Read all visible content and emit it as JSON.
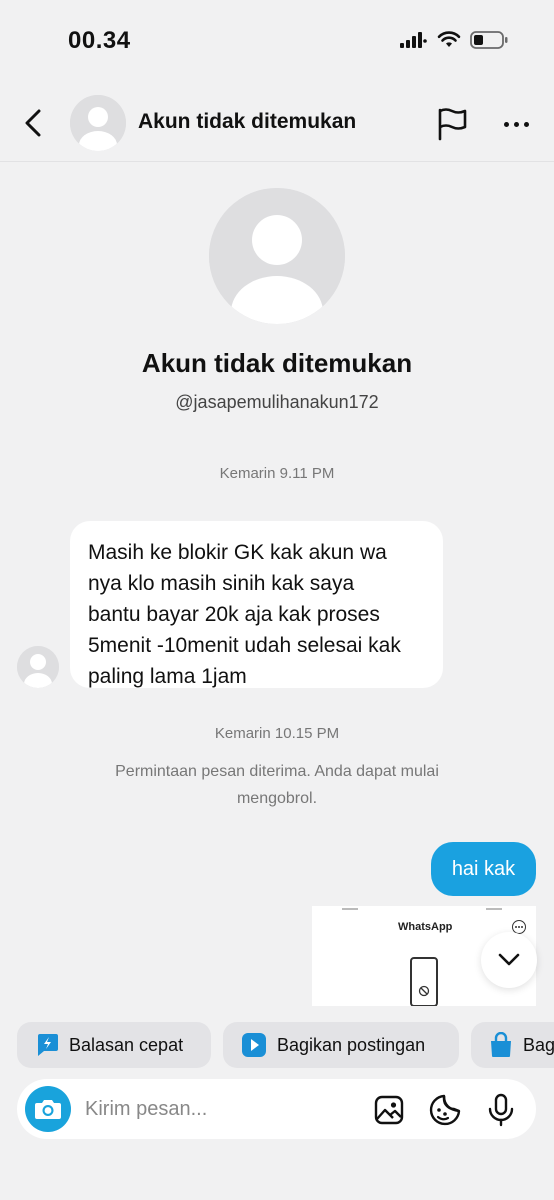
{
  "status_bar": {
    "time": "00.34",
    "icons": [
      "cellular-signal-icon",
      "wifi-icon",
      "battery-icon"
    ]
  },
  "header": {
    "title": "Akun tidak ditemukan",
    "icons": [
      "back-chevron-icon",
      "default-avatar-icon",
      "flag-icon",
      "more-options-icon"
    ]
  },
  "profile": {
    "name": "Akun tidak ditemukan",
    "handle": "@jasapemulihanakun172"
  },
  "messages": [
    {
      "type": "timestamp",
      "text": "Kemarin 9.11 PM"
    },
    {
      "type": "incoming",
      "lines": [
        "Masih ke blokir GK kak akun wa",
        "nya klo masih sinih kak saya",
        "bantu bayar 20k aja kak proses",
        "5menit -10menit udah selesai kak",
        "paling lama 1jam"
      ]
    },
    {
      "type": "timestamp",
      "text": "Kemarin 10.15 PM"
    },
    {
      "type": "system",
      "lines": [
        "Permintaan pesan diterima. Anda dapat mulai",
        "mengobrol."
      ]
    },
    {
      "type": "outgoing",
      "text": "hai kak"
    },
    {
      "type": "shared_screenshot",
      "title": "WhatsApp"
    }
  ],
  "quick_actions": [
    {
      "label": "Balasan cepat",
      "icon": "quick-reply-icon"
    },
    {
      "label": "Bagikan postingan",
      "icon": "share-post-icon"
    },
    {
      "label": "Bag",
      "icon": "shopping-bag-icon"
    }
  ],
  "composer": {
    "placeholder": "Kirim pesan...",
    "icons": [
      "camera-icon",
      "image-gallery-icon",
      "sticker-icon",
      "microphone-icon"
    ]
  },
  "colors": {
    "background": "#f1f1f2",
    "accent": "#1aa1e0",
    "camera_button": "#19a3dc",
    "chip_background": "#e3e3e6"
  }
}
